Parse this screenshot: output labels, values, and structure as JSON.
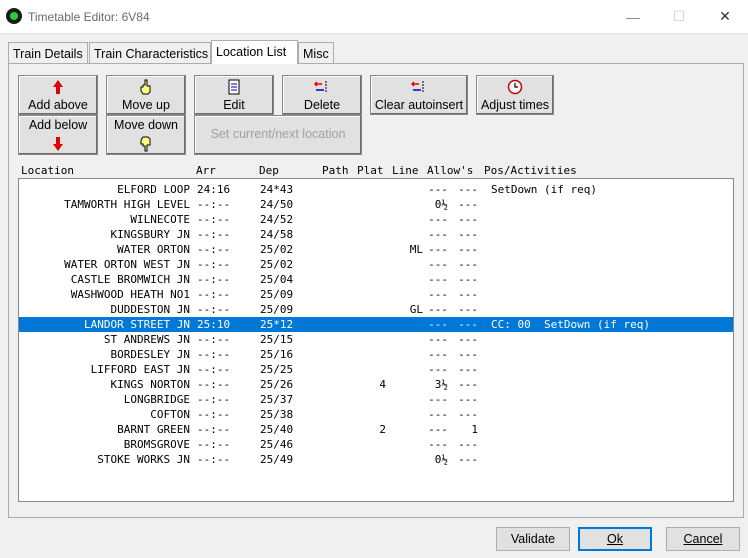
{
  "window": {
    "title": "Timetable Editor: 6V84",
    "minimize_glyph": "—",
    "maximize_glyph": "☐",
    "close_glyph": "✕"
  },
  "tabs": [
    {
      "label": "Train Details"
    },
    {
      "label": "Train Characteristics"
    },
    {
      "label": "Location List",
      "active": true
    },
    {
      "label": "Misc"
    }
  ],
  "toolbar": {
    "add_above": "Add above",
    "add_below": "Add below",
    "move_up": "Move up",
    "move_down": "Move down",
    "edit": "Edit",
    "delete": "Delete",
    "clear_autoinsert": "Clear autoinsert",
    "adjust_times": "Adjust times",
    "set_current_next": "Set current/next location"
  },
  "list": {
    "columns": {
      "location": "Location",
      "arr": "Arr",
      "dep": "Dep",
      "path": "Path",
      "plat": "Plat",
      "line": "Line",
      "allows": "Allow's",
      "pos": "Pos/Activities"
    },
    "rows": [
      {
        "loc": "ELFORD LOOP",
        "arr": "24:16",
        "dep": "24*43",
        "path": "",
        "plat": "",
        "line": "",
        "a1": "---",
        "a2": "---",
        "act": "SetDown (if req)"
      },
      {
        "loc": "TAMWORTH HIGH LEVEL",
        "arr": "--:--",
        "dep": "24/50",
        "path": "",
        "plat": "",
        "line": "",
        "a1": "0½",
        "a2": "---",
        "act": ""
      },
      {
        "loc": "WILNECOTE",
        "arr": "--:--",
        "dep": "24/52",
        "path": "",
        "plat": "",
        "line": "",
        "a1": "---",
        "a2": "---",
        "act": ""
      },
      {
        "loc": "KINGSBURY JN",
        "arr": "--:--",
        "dep": "24/58",
        "path": "",
        "plat": "",
        "line": "",
        "a1": "---",
        "a2": "---",
        "act": ""
      },
      {
        "loc": "WATER ORTON",
        "arr": "--:--",
        "dep": "25/02",
        "path": "",
        "plat": "",
        "line": "ML",
        "a1": "---",
        "a2": "---",
        "act": ""
      },
      {
        "loc": "WATER ORTON WEST JN",
        "arr": "--:--",
        "dep": "25/02",
        "path": "",
        "plat": "",
        "line": "",
        "a1": "---",
        "a2": "---",
        "act": ""
      },
      {
        "loc": "CASTLE BROMWICH JN",
        "arr": "--:--",
        "dep": "25/04",
        "path": "",
        "plat": "",
        "line": "",
        "a1": "---",
        "a2": "---",
        "act": ""
      },
      {
        "loc": "WASHWOOD HEATH NO1",
        "arr": "--:--",
        "dep": "25/09",
        "path": "",
        "plat": "",
        "line": "",
        "a1": "---",
        "a2": "---",
        "act": ""
      },
      {
        "loc": "DUDDESTON JN",
        "arr": "--:--",
        "dep": "25/09",
        "path": "",
        "plat": "",
        "line": "GL",
        "a1": "---",
        "a2": "---",
        "act": ""
      },
      {
        "loc": "LANDOR STREET JN",
        "arr": "25:10",
        "dep": "25*12",
        "path": "",
        "plat": "",
        "line": "",
        "a1": "---",
        "a2": "---",
        "act": "CC: 00  SetDown (if req)",
        "selected": true
      },
      {
        "loc": "ST ANDREWS JN",
        "arr": "--:--",
        "dep": "25/15",
        "path": "",
        "plat": "",
        "line": "",
        "a1": "---",
        "a2": "---",
        "act": ""
      },
      {
        "loc": "BORDESLEY JN",
        "arr": "--:--",
        "dep": "25/16",
        "path": "",
        "plat": "",
        "line": "",
        "a1": "---",
        "a2": "---",
        "act": ""
      },
      {
        "loc": "LIFFORD EAST JN",
        "arr": "--:--",
        "dep": "25/25",
        "path": "",
        "plat": "",
        "line": "",
        "a1": "---",
        "a2": "---",
        "act": ""
      },
      {
        "loc": "KINGS NORTON",
        "arr": "--:--",
        "dep": "25/26",
        "path": "",
        "plat": "4",
        "line": "",
        "a1": "3½",
        "a2": "---",
        "act": ""
      },
      {
        "loc": "LONGBRIDGE",
        "arr": "--:--",
        "dep": "25/37",
        "path": "",
        "plat": "",
        "line": "",
        "a1": "---",
        "a2": "---",
        "act": ""
      },
      {
        "loc": "COFTON",
        "arr": "--:--",
        "dep": "25/38",
        "path": "",
        "plat": "",
        "line": "",
        "a1": "---",
        "a2": "---",
        "act": ""
      },
      {
        "loc": "BARNT GREEN",
        "arr": "--:--",
        "dep": "25/40",
        "path": "",
        "plat": "2",
        "line": "",
        "a1": "---",
        "a2": "1",
        "act": ""
      },
      {
        "loc": "BROMSGROVE",
        "arr": "--:--",
        "dep": "25/46",
        "path": "",
        "plat": "",
        "line": "",
        "a1": "---",
        "a2": "---",
        "act": ""
      },
      {
        "loc": "STOKE WORKS JN",
        "arr": "--:--",
        "dep": "25/49",
        "path": "",
        "plat": "",
        "line": "",
        "a1": "0½",
        "a2": "---",
        "act": ""
      }
    ]
  },
  "footer": {
    "validate": "Validate",
    "ok": "Ok",
    "cancel": "Cancel"
  },
  "colors": {
    "selection": "#0078d7",
    "arrow_red": "#e00000",
    "icon_blue": "#0000c0"
  }
}
